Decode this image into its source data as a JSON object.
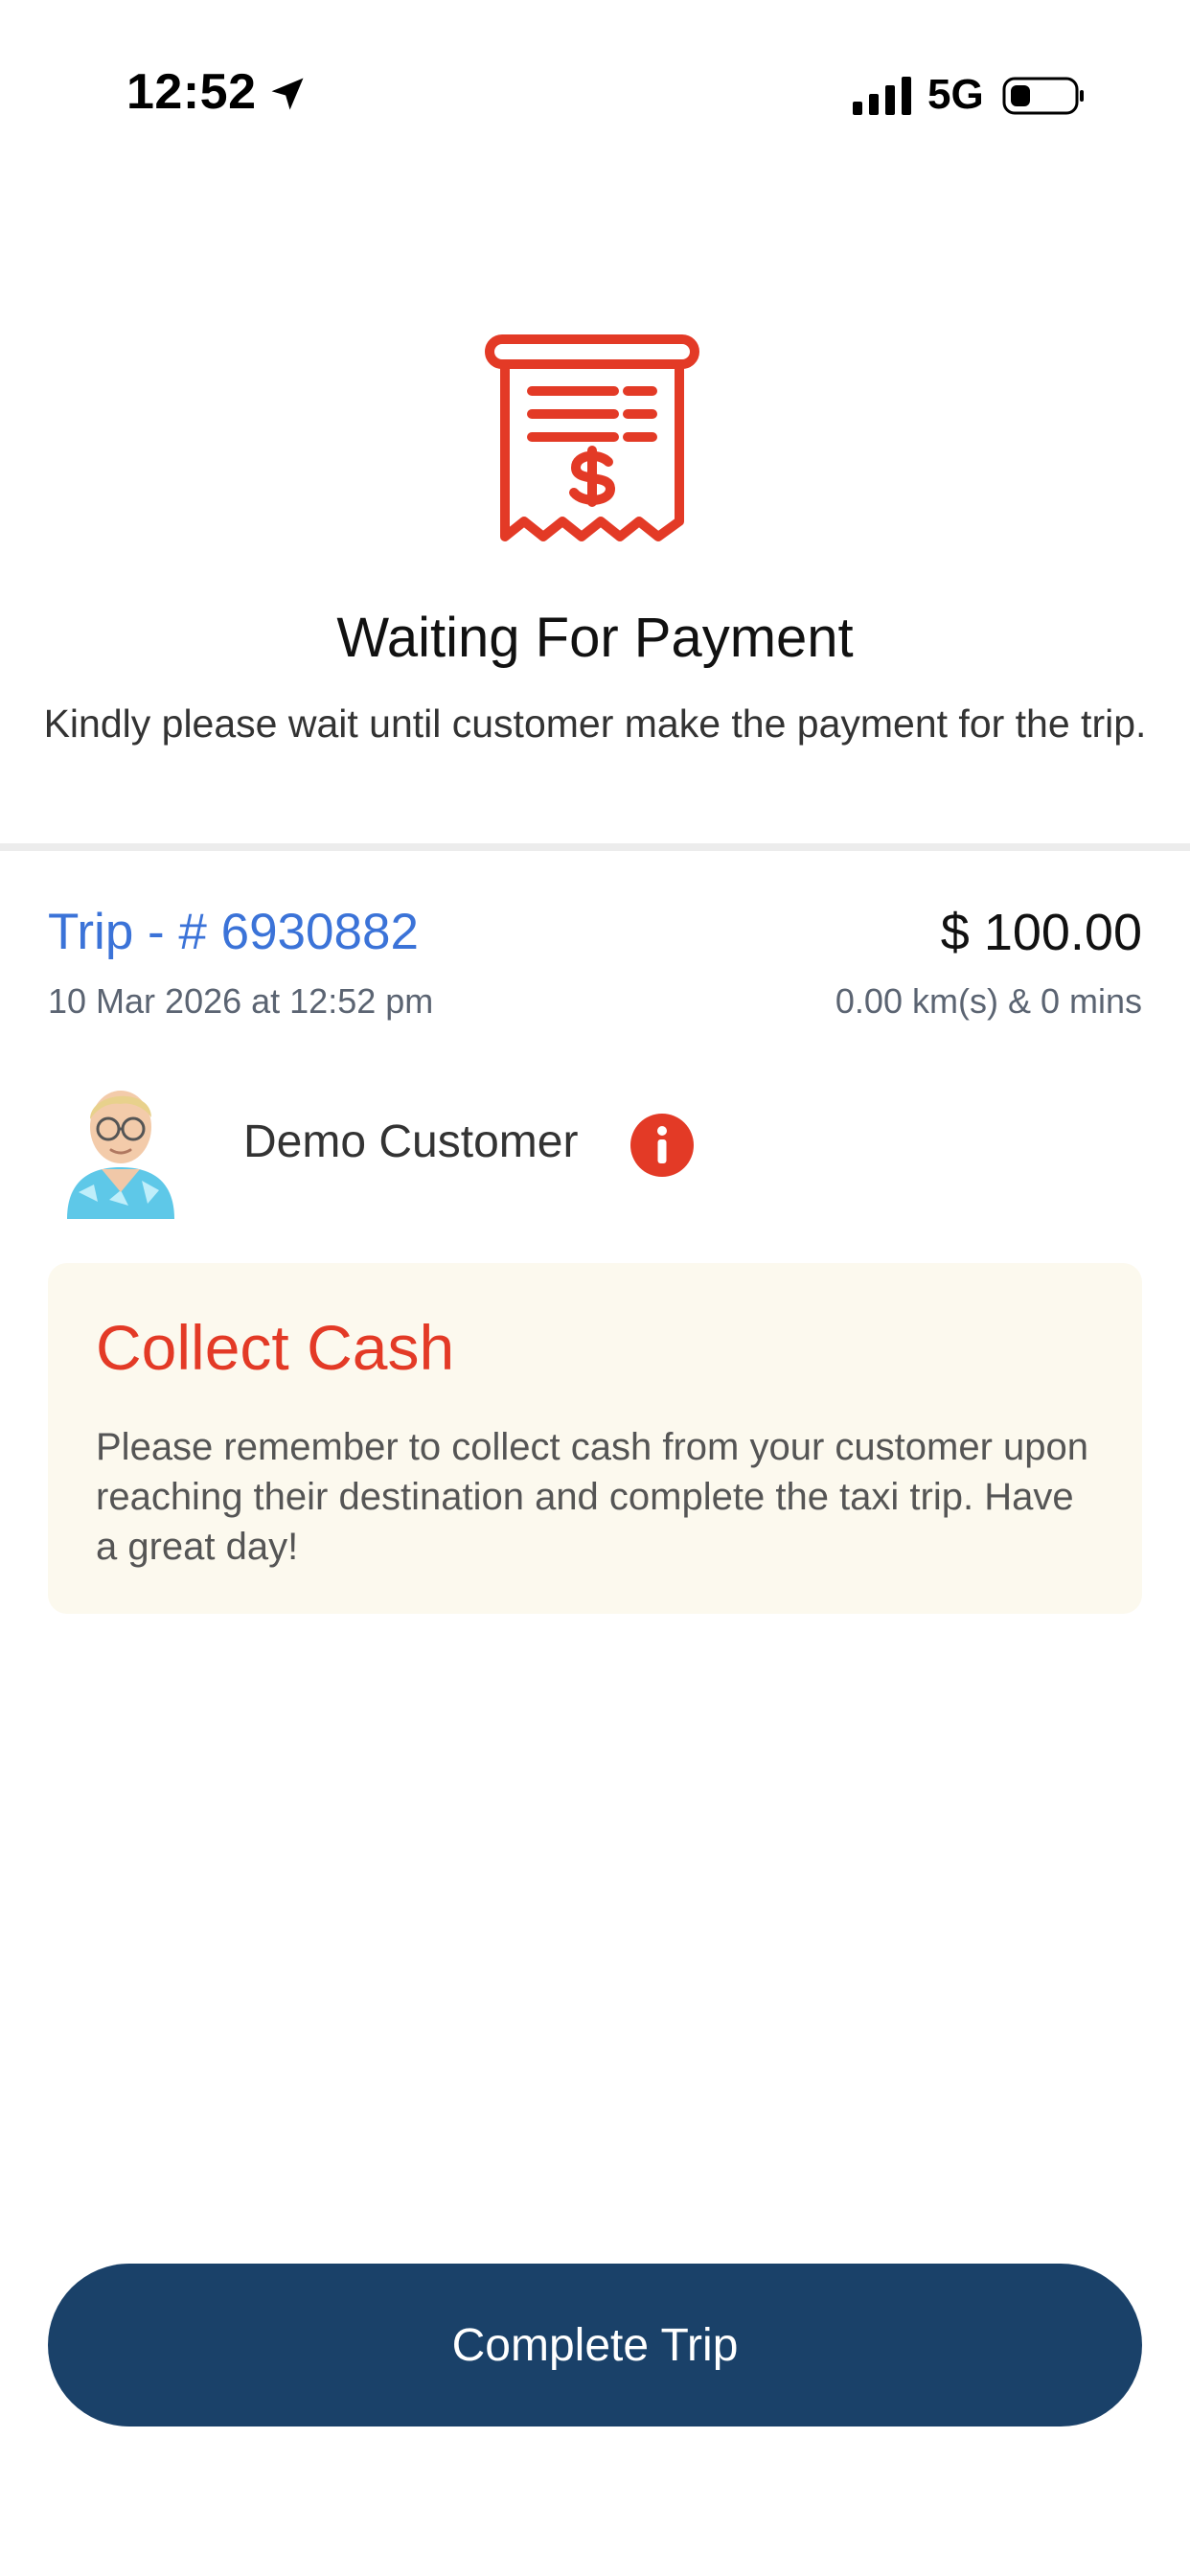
{
  "status_bar": {
    "time": "12:52",
    "network": "5G",
    "icons": [
      "location-arrow-icon",
      "cellular-signal-icon",
      "battery-icon"
    ]
  },
  "header": {
    "icon": "receipt-dollar-icon",
    "title": "Waiting For Payment",
    "subtitle": "Kindly please wait until customer make the payment for the trip."
  },
  "trip": {
    "number": "Trip - # 6930882",
    "date": "10 Mar 2026 at 12:52 pm",
    "price": "$ 100.00",
    "stats": "0.00 km(s) & 0 mins"
  },
  "customer": {
    "name": "Demo Customer",
    "icons": [
      "avatar",
      "info-icon"
    ]
  },
  "cash_notice": {
    "title": "Collect Cash",
    "body": "Please remember to collect cash from your customer upon reaching their destination and complete the taxi trip. Have a great day!"
  },
  "actions": {
    "complete_label": "Complete Trip"
  },
  "colors": {
    "accent_red": "#e33a26",
    "link_blue": "#3b73d8",
    "button_navy": "#1a4169",
    "notice_bg": "#fcf9ee"
  }
}
